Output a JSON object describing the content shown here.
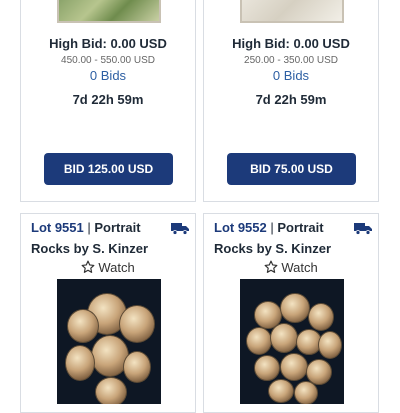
{
  "top_cards": [
    {
      "high_bid": "High Bid: 0.00 USD",
      "estimate": "450.00 - 550.00 USD",
      "bids": "0 Bids",
      "timer": "7d 22h 59m",
      "button": "BID 125.00 USD"
    },
    {
      "high_bid": "High Bid: 0.00 USD",
      "estimate": "250.00 - 350.00 USD",
      "bids": "0 Bids",
      "timer": "7d 22h 59m",
      "button": "BID 75.00 USD"
    }
  ],
  "bottom_cards": [
    {
      "lot": "Lot 9551",
      "separator": " | ",
      "category": "Portrait",
      "title": "Rocks by S. Kinzer",
      "watch": "Watch",
      "icon": "truck-icon"
    },
    {
      "lot": "Lot 9552",
      "separator": " | ",
      "category": "Portrait",
      "title": "Rocks by S. Kinzer",
      "watch": "Watch",
      "icon": "truck-icon"
    }
  ],
  "colors": {
    "accent": "#1c3a7a",
    "link": "#2d5fa3"
  }
}
